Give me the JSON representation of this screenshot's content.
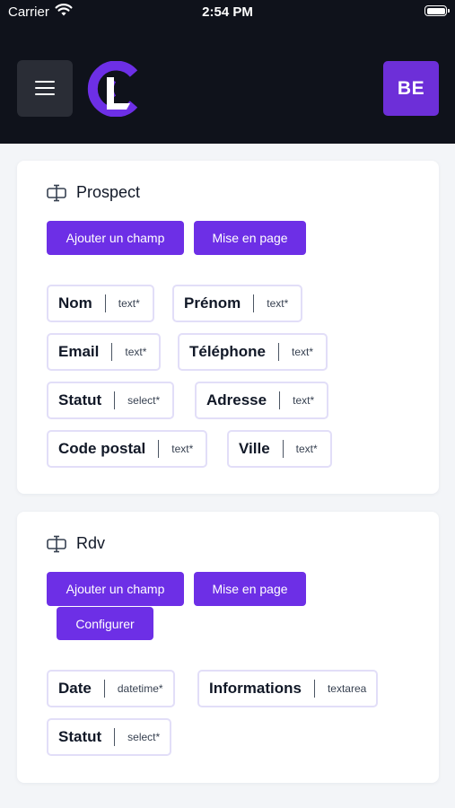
{
  "status_bar": {
    "carrier": "Carrier",
    "time": "2:54 PM"
  },
  "header": {
    "avatar_initials": "BE",
    "accent_color": "#6d2fd8"
  },
  "sections": [
    {
      "title": "Prospect",
      "buttons": [
        "Ajouter un champ",
        "Mise en page"
      ],
      "fields": [
        {
          "name": "Nom",
          "type": "text*"
        },
        {
          "name": "Prénom",
          "type": "text*"
        },
        {
          "name": "Email",
          "type": "text*"
        },
        {
          "name": "Téléphone",
          "type": "text*"
        },
        {
          "name": "Statut",
          "type": "select*"
        },
        {
          "name": "Adresse",
          "type": "text*"
        },
        {
          "name": "Code postal",
          "type": "text*"
        },
        {
          "name": "Ville",
          "type": "text*"
        }
      ]
    },
    {
      "title": "Rdv",
      "buttons": [
        "Ajouter un champ",
        "Mise en page",
        "Configurer"
      ],
      "fields": [
        {
          "name": "Date",
          "type": "datetime*"
        },
        {
          "name": "Informations",
          "type": "textarea"
        },
        {
          "name": "Statut",
          "type": "select*"
        }
      ]
    }
  ]
}
